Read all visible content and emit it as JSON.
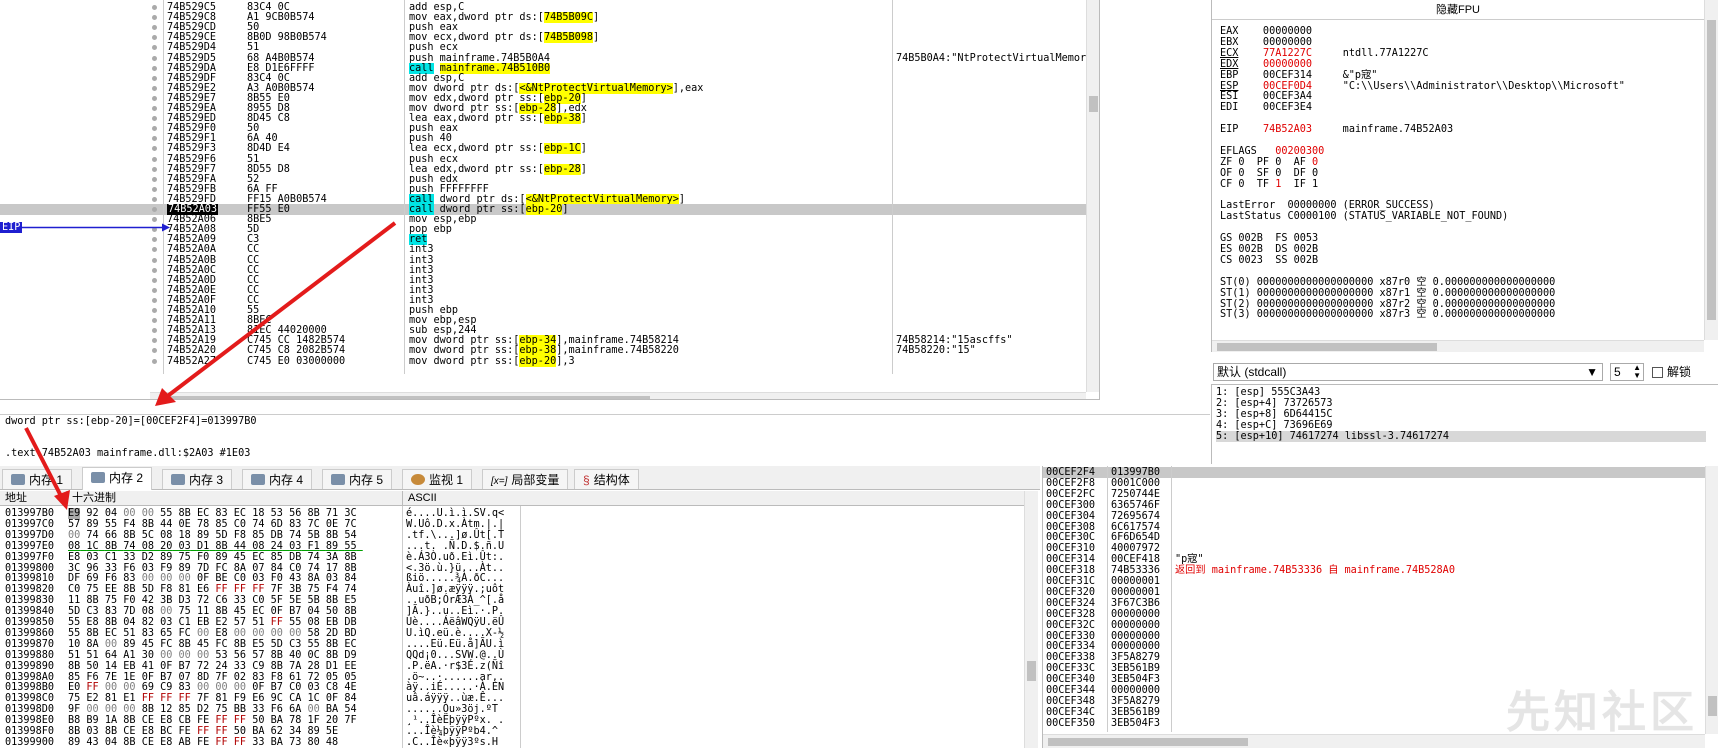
{
  "disasm": {
    "rows": [
      {
        "addr": "74B529C5",
        "bytes": "83C4 0C",
        "ins": "add esp,C",
        "cmt": ""
      },
      {
        "addr": "74B529C8",
        "bytes": "A1 9CB0B574",
        "ins": "mov eax,dword ptr ds:[74B5B09C]",
        "cmt": ""
      },
      {
        "addr": "74B529CD",
        "bytes": "50",
        "ins": "push eax",
        "cmt": ""
      },
      {
        "addr": "74B529CE",
        "bytes": "8B0D 98B0B574",
        "ins": "mov ecx,dword ptr ds:[74B5B098]",
        "cmt": ""
      },
      {
        "addr": "74B529D4",
        "bytes": "51",
        "ins": "push ecx",
        "cmt": ""
      },
      {
        "addr": "74B529D5",
        "bytes": "68 A4B0B574",
        "ins": "push mainframe.74B5B0A4",
        "cmt": "74B5B0A4:\"NtProtectVirtualMemory\""
      },
      {
        "addr": "74B529DA",
        "bytes": "E8 D1E6FFFF",
        "ins": "call mainframe.74B510B0",
        "cmt": ""
      },
      {
        "addr": "74B529DF",
        "bytes": "83C4 0C",
        "ins": "add esp,C",
        "cmt": ""
      },
      {
        "addr": "74B529E2",
        "bytes": "A3 A0B0B574",
        "ins": "mov dword ptr ds:[<&NtProtectVirtualMemory>],eax",
        "cmt": ""
      },
      {
        "addr": "74B529E7",
        "bytes": "8B55 E0",
        "ins": "mov edx,dword ptr ss:[ebp-20]",
        "cmt": ""
      },
      {
        "addr": "74B529EA",
        "bytes": "8955 D8",
        "ins": "mov dword ptr ss:[ebp-28],edx",
        "cmt": ""
      },
      {
        "addr": "74B529ED",
        "bytes": "8D45 C8",
        "ins": "lea eax,dword ptr ss:[ebp-38]",
        "cmt": ""
      },
      {
        "addr": "74B529F0",
        "bytes": "50",
        "ins": "push eax",
        "cmt": ""
      },
      {
        "addr": "74B529F1",
        "bytes": "6A 40",
        "ins": "push 40",
        "cmt": ""
      },
      {
        "addr": "74B529F3",
        "bytes": "8D4D E4",
        "ins": "lea ecx,dword ptr ss:[ebp-1C]",
        "cmt": ""
      },
      {
        "addr": "74B529F6",
        "bytes": "51",
        "ins": "push ecx",
        "cmt": ""
      },
      {
        "addr": "74B529F7",
        "bytes": "8D55 D8",
        "ins": "lea edx,dword ptr ss:[ebp-28]",
        "cmt": ""
      },
      {
        "addr": "74B529FA",
        "bytes": "52",
        "ins": "push edx",
        "cmt": ""
      },
      {
        "addr": "74B529FB",
        "bytes": "6A FF",
        "ins": "push FFFFFFFF",
        "cmt": ""
      },
      {
        "addr": "74B529FD",
        "bytes": "FF15 A0B0B574",
        "ins": "call dword ptr ds:[<&NtProtectVirtualMemory>]",
        "cmt": ""
      },
      {
        "addr": "74B52A03",
        "bytes": "FF55 E0",
        "ins": "call dword ptr ss:[ebp-20]",
        "cmt": ""
      },
      {
        "addr": "74B52A06",
        "bytes": "8BE5",
        "ins": "mov esp,ebp",
        "cmt": ""
      },
      {
        "addr": "74B52A08",
        "bytes": "5D",
        "ins": "pop ebp",
        "cmt": ""
      },
      {
        "addr": "74B52A09",
        "bytes": "C3",
        "ins": "ret",
        "cmt": ""
      },
      {
        "addr": "74B52A0A",
        "bytes": "CC",
        "ins": "int3",
        "cmt": ""
      },
      {
        "addr": "74B52A0B",
        "bytes": "CC",
        "ins": "int3",
        "cmt": ""
      },
      {
        "addr": "74B52A0C",
        "bytes": "CC",
        "ins": "int3",
        "cmt": ""
      },
      {
        "addr": "74B52A0D",
        "bytes": "CC",
        "ins": "int3",
        "cmt": ""
      },
      {
        "addr": "74B52A0E",
        "bytes": "CC",
        "ins": "int3",
        "cmt": ""
      },
      {
        "addr": "74B52A0F",
        "bytes": "CC",
        "ins": "int3",
        "cmt": ""
      },
      {
        "addr": "74B52A10",
        "bytes": "55",
        "ins": "push ebp",
        "cmt": ""
      },
      {
        "addr": "74B52A11",
        "bytes": "8BEC",
        "ins": "mov ebp,esp",
        "cmt": ""
      },
      {
        "addr": "74B52A13",
        "bytes": "81EC 44020000",
        "ins": "sub esp,244",
        "cmt": ""
      },
      {
        "addr": "74B52A19",
        "bytes": "C745 CC 1482B574",
        "ins": "mov dword ptr ss:[ebp-34],mainframe.74B58214",
        "cmt": "74B58214:\"15ascffs\""
      },
      {
        "addr": "74B52A20",
        "bytes": "C745 C8 2082B574",
        "ins": "mov dword ptr ss:[ebp-38],mainframe.74B58220",
        "cmt": "74B58220:\"15\""
      },
      {
        "addr": "74B52A27",
        "bytes": "C745 E0 03000000",
        "ins": "mov dword ptr ss:[ebp-20],3",
        "cmt": ""
      }
    ],
    "eip_label": "EIP",
    "info_line": "dword ptr ss:[ebp-20]=[00CEF2F4]=013997B0",
    "section_line": ".text:74B52A03 mainframe.dll:$2A03 #1E03"
  },
  "registers": {
    "header": "隐藏FPU",
    "lines": [
      "EAX    00000000",
      "EBX    00000000",
      "ECX    77A1227C     ntdll.77A1227C",
      "EDX    00000000",
      "EBP    00CEF314     &\"p宼\"",
      "ESP    00CEF0D4     \"C:\\\\Users\\\\Administrator\\\\Desktop\\\\Microsoft\"",
      "ESI    00CEF3A4",
      "EDI    00CEF3E4",
      "",
      "EIP    74B52A03     mainframe.74B52A03",
      "",
      "EFLAGS   00200300",
      "ZF 0  PF 0  AF 0",
      "OF 0  SF 0  DF 0",
      "CF 0  TF 1  IF 1",
      "",
      "LastError  00000000 (ERROR_SUCCESS)",
      "LastStatus C0000100 (STATUS_VARIABLE_NOT_FOUND)",
      "",
      "GS 002B  FS 0053",
      "ES 002B  DS 002B",
      "CS 0023  SS 002B",
      "",
      "ST(0) 0000000000000000000 x87r0 空 0.000000000000000000",
      "ST(1) 0000000000000000000 x87r1 空 0.000000000000000000",
      "ST(2) 0000000000000000000 x87r2 空 0.000000000000000000",
      "ST(3) 0000000000000000000 x87r3 空 0.000000000000000000"
    ]
  },
  "call_conv": {
    "selected": "默认 (stdcall)",
    "count": "5",
    "unlock_label": "解锁",
    "args": [
      "1: [esp] 555C3A43",
      "2: [esp+4] 73726573",
      "3: [esp+8] 6D64415C",
      "4: [esp+C] 73696E69",
      "5: [esp+10] 74617274 libssl-3.74617274"
    ]
  },
  "tabs": [
    {
      "label": "内存 1"
    },
    {
      "label": "内存 2"
    },
    {
      "label": "内存 3"
    },
    {
      "label": "内存 4"
    },
    {
      "label": "内存 5"
    },
    {
      "label": "监视 1"
    },
    {
      "label": "局部变量"
    },
    {
      "label": "结构体"
    }
  ],
  "dump": {
    "col_addr": "地址",
    "col_hex": "十六进制",
    "col_ascii": "ASCII",
    "rows": [
      {
        "a": "013997B0",
        "h": "E9 92 04 00 00 55 8B EC 83 EC 18 53 56 8B 71 3C",
        "s": "é....U.ì.ì.SV.q<"
      },
      {
        "a": "013997C0",
        "h": "57 89 55 F4 8B 44 0E 78 85 C0 74 6D 83 7C 0E 7C",
        "s": "W.Uô.D.x.Àtm.|.|"
      },
      {
        "a": "013997D0",
        "h": "00 74 66 8B 5C 08 18 89 5D F8 85 DB 74 5B 8B 54",
        "s": ".tf.\\...]ø.Ût[.T"
      },
      {
        "a": "013997E0",
        "h": "08 1C 8B 74 08 20 03 D1 8B 44 08 24 03 F1 89 55",
        "s": "...t. .Ñ.D.$.ñ.U"
      },
      {
        "a": "013997F0",
        "h": "E8 03 C1 33 D2 89 75 F0 89 45 EC 85 DB 74 3A 8B",
        "s": "è.Á3Ò.uð.Eì.Ût:."
      },
      {
        "a": "01399800",
        "h": "3C 96 33 F6 03 F9 89 7D FC 8A 07 84 C0 74 17 8B",
        "s": "<.3ö.ù.}ü...Àt.."
      },
      {
        "a": "01399810",
        "h": "DF 69 F6 83 00 00 00 0F BE C0 03 F0 43 8A 03 84",
        "s": "ßiö.....¾À.ðC..."
      },
      {
        "a": "01399820",
        "h": "C0 75 EE 8B 5D F8 81 E6 FF FF FF 7F 3B 75 F4 74",
        "s": "Àuî.]ø.æÿÿÿ.;uôt"
      },
      {
        "a": "01399830",
        "h": "11 8B 75 F0 42 3B D3 72 C6 33 C0 5F 5E 5B 8B E5",
        "s": "..uðB;ÓrÆ3À_^[.å"
      },
      {
        "a": "01399840",
        "h": "5D C3 83 7D 08 00 75 11 8B 45 EC 0F B7 04 50 8B",
        "s": "]Ã.}..u..Eì.·.P."
      },
      {
        "a": "01399850",
        "h": "55 E8 8B 04 82 03 C1 EB E2 57 51 FF 55 08 EB DB",
        "s": "Uè....ÁëâWQÿU.ëÛ"
      },
      {
        "a": "01399860",
        "h": "55 8B EC 51 83 65 FC 00 E8 00 00 00 00 58 2D BD",
        "s": "U.ìQ.eü.è....X-½"
      },
      {
        "a": "01399870",
        "h": "10 8A 00 89 45 FC 8B 45 FC 8B E5 5D C3 55 8B EC",
        "s": "....Eü.Eü.å]ÃU.ì"
      },
      {
        "a": "01399880",
        "h": "51 51 64 A1 30 00 00 00 53 56 57 8B 40 0C 8B D9",
        "s": "QQd¡0...SVW.@..Ù"
      },
      {
        "a": "01399890",
        "h": "8B 50 14 EB 41 0F B7 72 24 33 C9 8B 7A 28 D1 EE",
        "s": ".P.ëA.·r$3É.z(Ñî"
      },
      {
        "a": "013998A0",
        "h": "85 F6 7E 1E 0F B7 07 8D 7F 02 83 F8 61 72 05 05",
        "s": ".ö~..·......ar.."
      },
      {
        "a": "013998B0",
        "h": "E0 FF 00 00 69 C9 83 00 00 00 0F B7 C0 03 C8 4E",
        "s": "àÿ..iÉ.....·À.ÈN"
      },
      {
        "a": "013998C0",
        "h": "75 E2 81 E1 FF FF FF 7F 81 F9 E6 9C CA 1C 0F 84",
        "s": "uâ.áÿÿÿ..ùæ.Ê..."
      },
      {
        "a": "013998D0",
        "h": "9F 00 00 00 8B 12 85 D2 75 BB 33 F6 6A 00 BA 54",
        "s": "......Òu»3öj.ºT"
      },
      {
        "a": "013998E0",
        "h": "B8 B9 1A 8B CE E8 CB FE FF FF 50 BA 78 1F 20 7F",
        "s": "¸¹..ÎèËþÿÿPºx. ."
      },
      {
        "a": "013998F0",
        "h": "8B 03 8B CE E8 BC FE FF FF 50 BA 62 34 89 5E",
        "s": "...Îè¼þÿÿPºb4.^"
      },
      {
        "a": "01399900",
        "h": "89 43 04 8B CE E8 AB FE FF FF 33 BA 73 80 48",
        "s": ".C..Îè«þÿÿ3ºs.H"
      }
    ]
  },
  "stack": {
    "rows": [
      {
        "a": "00CEF2F4",
        "v": "013997B0",
        "c": ""
      },
      {
        "a": "00CEF2F8",
        "v": "0001C000",
        "c": ""
      },
      {
        "a": "00CEF2FC",
        "v": "7250744E",
        "c": ""
      },
      {
        "a": "00CEF300",
        "v": "6365746F",
        "c": ""
      },
      {
        "a": "00CEF304",
        "v": "72695674",
        "c": ""
      },
      {
        "a": "00CEF308",
        "v": "6C617574",
        "c": ""
      },
      {
        "a": "00CEF30C",
        "v": "6F6D654D",
        "c": ""
      },
      {
        "a": "00CEF310",
        "v": "40007972",
        "c": ""
      },
      {
        "a": "00CEF314",
        "v": "00CEF418",
        "c": "\"p宼\""
      },
      {
        "a": "00CEF318",
        "v": "74B53336",
        "c": "返回到 mainframe.74B53336 自 mainframe.74B528A0"
      },
      {
        "a": "00CEF31C",
        "v": "00000001",
        "c": ""
      },
      {
        "a": "00CEF320",
        "v": "00000001",
        "c": ""
      },
      {
        "a": "00CEF324",
        "v": "3F67C3B6",
        "c": ""
      },
      {
        "a": "00CEF328",
        "v": "00000000",
        "c": ""
      },
      {
        "a": "00CEF32C",
        "v": "00000000",
        "c": ""
      },
      {
        "a": "00CEF330",
        "v": "00000000",
        "c": ""
      },
      {
        "a": "00CEF334",
        "v": "00000000",
        "c": ""
      },
      {
        "a": "00CEF338",
        "v": "3F5A8279",
        "c": ""
      },
      {
        "a": "00CEF33C",
        "v": "3EB561B9",
        "c": ""
      },
      {
        "a": "00CEF340",
        "v": "3EB504F3",
        "c": ""
      },
      {
        "a": "00CEF344",
        "v": "00000000",
        "c": ""
      },
      {
        "a": "00CEF348",
        "v": "3F5A8279",
        "c": ""
      },
      {
        "a": "00CEF34C",
        "v": "3EB561B9",
        "c": ""
      },
      {
        "a": "00CEF350",
        "v": "3EB504F3",
        "c": ""
      }
    ]
  },
  "watermark": "先知社区",
  "colors": {
    "arrow": "#e31b1b",
    "eip": "#1f1fd0",
    "yellow": "#ffff00",
    "cyan": "#00e5e5"
  }
}
